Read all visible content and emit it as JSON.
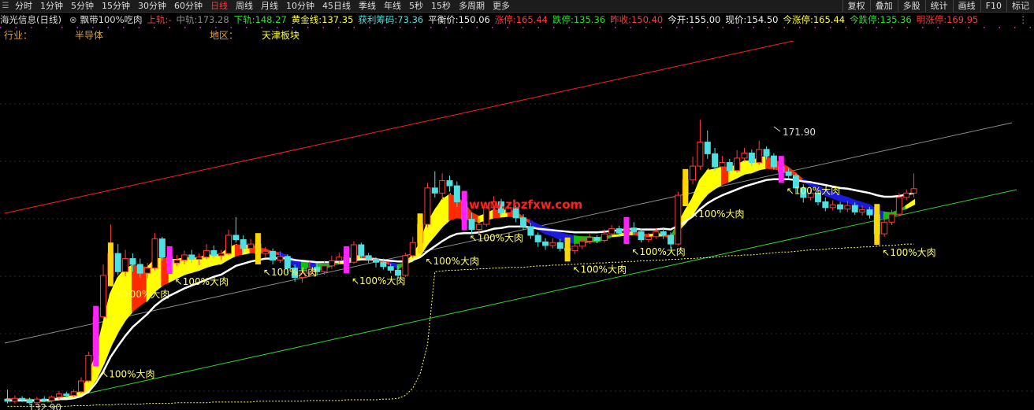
{
  "toolbar": {
    "periods": [
      "分时",
      "1分钟",
      "5分钟",
      "15分钟",
      "30分钟",
      "60分钟",
      "日线",
      "周线",
      "月线",
      "10分钟",
      "45日线",
      "季线",
      "年线",
      "5秒",
      "15秒",
      "多周期",
      "更多"
    ],
    "active_index": 6,
    "right_buttons": [
      "复权",
      "叠加",
      "多股",
      "统计",
      "画线",
      "F10",
      "标记"
    ]
  },
  "info": {
    "stock_title": "海光信息(日线)",
    "indicator_name": "飘带100%吃肉",
    "upper_label": "上轨:",
    "upper_value": "-",
    "mid_label": "中轨:",
    "mid_value": "173.28",
    "lower_label": "下轨:",
    "lower_value": "148.27",
    "gold_label": "黄金线:",
    "gold_value": "137.35",
    "profit_label": "获利筹码:",
    "profit_value": "73.36",
    "balance_label": "平衡价:",
    "balance_value": "150.06",
    "limitup_label": "涨停:",
    "limitup_value": "165.44",
    "limitdown_label": "跌停:",
    "limitdown_value": "135.36",
    "prevclose_label": "昨收:",
    "prevclose_value": "150.40",
    "open_label": "今开:",
    "open_value": "155.00",
    "price_label": "现价:",
    "price_value": "154.50",
    "todayup_label": "今涨停:",
    "todayup_value": "165.44",
    "todaydown_label": "今跌停:",
    "todaydown_value": "135.36",
    "tomorrowup_label": "明涨停:",
    "tomorrowup_value": "169.95"
  },
  "industry": {
    "industry_label": "行业：",
    "industry_value": "半导体",
    "region_label": "地区：",
    "region_value": "天津板块"
  },
  "colors": {
    "up": "#ff3b3b",
    "down": "#4de1e1",
    "ribbon_yellow": "#ffff00",
    "ribbon_red": "#ff2a00",
    "ribbon_blue": "#1b1bdd",
    "ribbon_green": "#10c010",
    "ribbon_white": "#ffffff",
    "signal_magenta": "#ff22ff",
    "signal_yellow": "#ffd700",
    "label_text": "#ffff66",
    "channel_top": "#ff2020",
    "channel_mid": "#8a8a8a",
    "channel_bottom": "#30d030",
    "profit_dotted": "#ffff55"
  },
  "chart_data": {
    "type": "candlestick",
    "title": "",
    "ylim": [
      130,
      180
    ],
    "high_label": "171.90",
    "low_label": "132.90",
    "signal_label": "100%大肉",
    "watermark": "www.zbzfxw.com",
    "candles": [
      [
        133.5,
        133.2,
        134.8,
        132.9
      ],
      [
        133.2,
        133.6,
        134.0,
        132.9
      ],
      [
        133.6,
        133.4,
        133.9,
        133.1
      ],
      [
        133.4,
        133.0,
        133.7,
        132.9
      ],
      [
        133.0,
        133.5,
        133.8,
        132.9
      ],
      [
        133.5,
        133.3,
        133.9,
        133.1
      ],
      [
        133.3,
        133.8,
        134.0,
        133.0
      ],
      [
        133.8,
        134.2,
        134.6,
        133.5
      ],
      [
        134.2,
        134.0,
        134.5,
        133.7
      ],
      [
        134.0,
        134.5,
        134.8,
        133.8
      ],
      [
        134.5,
        136.0,
        136.5,
        134.3
      ],
      [
        136.0,
        139.5,
        140.0,
        135.8
      ],
      [
        139.5,
        144.8,
        145.5,
        139.0
      ],
      [
        144.8,
        150.5,
        152.0,
        144.5
      ],
      [
        150.5,
        153.5,
        157.5,
        150.0
      ],
      [
        153.5,
        151.0,
        154.8,
        150.5
      ],
      [
        151.0,
        152.8,
        154.0,
        150.4
      ],
      [
        152.8,
        152.0,
        153.5,
        151.0
      ],
      [
        152.0,
        150.8,
        152.8,
        150.2
      ],
      [
        150.8,
        151.5,
        152.2,
        150.1
      ],
      [
        151.5,
        155.5,
        156.3,
        151.2
      ],
      [
        155.5,
        153.0,
        155.8,
        152.5
      ],
      [
        153.0,
        152.2,
        153.8,
        151.5
      ],
      [
        152.2,
        152.6,
        153.3,
        151.8
      ],
      [
        152.6,
        153.3,
        153.9,
        152.0
      ],
      [
        153.3,
        152.7,
        154.0,
        152.2
      ],
      [
        152.7,
        153.0,
        153.5,
        151.9
      ],
      [
        153.0,
        153.9,
        154.8,
        152.7
      ],
      [
        153.9,
        153.2,
        154.6,
        152.8
      ],
      [
        153.2,
        153.5,
        154.0,
        152.6
      ],
      [
        153.5,
        156.0,
        156.8,
        153.3
      ],
      [
        156.0,
        155.4,
        158.5,
        155.0
      ],
      [
        155.4,
        154.2,
        156.0,
        153.6
      ],
      [
        154.2,
        154.8,
        155.5,
        153.8
      ],
      [
        154.8,
        153.5,
        155.3,
        153.0
      ],
      [
        153.5,
        153.8,
        154.4,
        153.0
      ],
      [
        153.8,
        152.6,
        154.2,
        152.0
      ],
      [
        152.6,
        153.1,
        153.8,
        152.2
      ],
      [
        153.1,
        151.5,
        153.4,
        150.8
      ],
      [
        151.5,
        150.2,
        152.0,
        149.6
      ],
      [
        150.2,
        150.8,
        151.5,
        149.5
      ],
      [
        150.8,
        151.6,
        152.4,
        150.4
      ],
      [
        151.6,
        151.0,
        152.0,
        150.5
      ],
      [
        151.0,
        151.8,
        152.5,
        150.6
      ],
      [
        151.8,
        152.5,
        153.2,
        151.4
      ],
      [
        152.5,
        153.0,
        153.6,
        152.0
      ],
      [
        153.0,
        152.3,
        153.4,
        151.9
      ],
      [
        152.3,
        154.7,
        155.2,
        152.1
      ],
      [
        154.7,
        153.2,
        155.0,
        152.8
      ],
      [
        153.2,
        152.7,
        153.6,
        152.2
      ],
      [
        152.7,
        152.3,
        153.0,
        151.6
      ],
      [
        152.3,
        151.7,
        152.8,
        151.3
      ],
      [
        151.7,
        151.2,
        152.1,
        150.8
      ],
      [
        151.2,
        150.5,
        151.8,
        150.1
      ],
      [
        150.5,
        153.2,
        153.6,
        150.3
      ],
      [
        153.2,
        155.0,
        155.8,
        152.9
      ],
      [
        155.0,
        157.5,
        158.4,
        154.7
      ],
      [
        157.5,
        162.5,
        163.2,
        157.1
      ],
      [
        162.5,
        161.8,
        164.8,
        161.2
      ],
      [
        161.8,
        163.5,
        164.5,
        160.9
      ],
      [
        163.5,
        162.8,
        164.2,
        162.0
      ],
      [
        162.8,
        160.6,
        163.4,
        159.9
      ],
      [
        160.6,
        158.2,
        161.2,
        157.5
      ],
      [
        158.2,
        156.8,
        159.1,
        156.2
      ],
      [
        156.8,
        157.5,
        158.3,
        156.1
      ],
      [
        157.5,
        159.8,
        160.5,
        157.2
      ],
      [
        159.8,
        160.6,
        161.4,
        159.2
      ],
      [
        160.6,
        159.1,
        161.0,
        158.7
      ],
      [
        159.1,
        159.8,
        160.5,
        158.8
      ],
      [
        159.8,
        158.4,
        160.1,
        157.8
      ],
      [
        158.4,
        157.2,
        158.9,
        156.7
      ],
      [
        157.2,
        156.0,
        157.7,
        155.5
      ],
      [
        156.0,
        155.1,
        156.4,
        154.4
      ],
      [
        155.1,
        154.6,
        155.6,
        154.0
      ],
      [
        154.6,
        155.0,
        155.6,
        154.2
      ],
      [
        155.0,
        154.2,
        155.5,
        153.8
      ],
      [
        154.2,
        153.9,
        154.7,
        153.2
      ],
      [
        153.9,
        154.5,
        155.0,
        153.4
      ],
      [
        154.5,
        155.2,
        155.8,
        154.1
      ],
      [
        155.2,
        155.7,
        156.2,
        154.8
      ],
      [
        155.7,
        155.3,
        156.0,
        154.9
      ],
      [
        155.3,
        156.2,
        156.8,
        155.0
      ],
      [
        156.2,
        156.9,
        157.4,
        155.9
      ],
      [
        156.9,
        156.3,
        157.3,
        155.8
      ],
      [
        156.3,
        157.0,
        157.5,
        155.9
      ],
      [
        157.0,
        156.5,
        157.8,
        156.1
      ],
      [
        156.5,
        155.4,
        156.9,
        155.0
      ],
      [
        155.4,
        155.8,
        156.3,
        155.0
      ],
      [
        155.8,
        156.5,
        157.0,
        155.5
      ],
      [
        156.5,
        156.0,
        156.9,
        155.5
      ],
      [
        156.0,
        154.8,
        156.4,
        154.2
      ],
      [
        154.8,
        161.5,
        162.0,
        154.6
      ],
      [
        161.5,
        163.6,
        164.8,
        161.0
      ],
      [
        163.6,
        165.5,
        166.8,
        163.0
      ],
      [
        165.5,
        168.8,
        171.9,
        165.0
      ],
      [
        168.8,
        167.2,
        170.4,
        166.5
      ],
      [
        167.2,
        165.4,
        168.0,
        164.8
      ],
      [
        165.4,
        166.0,
        166.9,
        164.8
      ],
      [
        166.0,
        164.9,
        166.5,
        164.3
      ],
      [
        164.9,
        166.6,
        167.7,
        164.6
      ],
      [
        166.6,
        167.3,
        168.0,
        166.2
      ],
      [
        167.3,
        166.0,
        167.8,
        165.5
      ],
      [
        166.0,
        167.8,
        169.0,
        165.7
      ],
      [
        167.8,
        166.9,
        168.2,
        166.4
      ],
      [
        166.9,
        165.4,
        167.3,
        165.0
      ],
      [
        165.4,
        164.7,
        165.9,
        164.2
      ],
      [
        164.7,
        164.2,
        165.2,
        163.7
      ],
      [
        164.2,
        162.5,
        164.5,
        161.8
      ],
      [
        162.5,
        161.2,
        163.0,
        160.5
      ],
      [
        161.2,
        161.8,
        162.3,
        160.8
      ],
      [
        161.8,
        160.6,
        162.2,
        160.1
      ],
      [
        160.6,
        159.8,
        161.2,
        159.3
      ],
      [
        159.8,
        160.2,
        160.8,
        159.4
      ],
      [
        160.2,
        159.6,
        160.6,
        159.1
      ],
      [
        159.6,
        160.1,
        160.7,
        159.2
      ],
      [
        160.1,
        159.2,
        160.5,
        158.8
      ],
      [
        159.2,
        159.5,
        160.1,
        158.7
      ],
      [
        159.5,
        158.8,
        159.9,
        158.3
      ],
      [
        158.8,
        156.2,
        159.1,
        154.9
      ],
      [
        156.2,
        157.8,
        158.2,
        155.8
      ],
      [
        157.8,
        158.9,
        159.5,
        157.4
      ],
      [
        158.9,
        161.2,
        161.8,
        158.6
      ],
      [
        161.2,
        161.8,
        162.3,
        160.8
      ],
      [
        161.8,
        162.4,
        164.5,
        161.2
      ]
    ],
    "ribbon_fast": [
      133.5,
      133.4,
      133.4,
      133.3,
      133.3,
      133.3,
      133.4,
      133.6,
      133.7,
      133.9,
      134.6,
      136.3,
      139.5,
      143.7,
      147.9,
      150.1,
      151.3,
      151.8,
      151.6,
      151.5,
      152.6,
      152.8,
      152.6,
      152.6,
      152.8,
      152.8,
      152.8,
      153.2,
      153.2,
      153.3,
      154.2,
      154.6,
      154.5,
      154.6,
      154.2,
      154.0,
      153.6,
      153.4,
      152.7,
      151.8,
      151.4,
      151.5,
      151.3,
      151.5,
      151.9,
      152.3,
      152.3,
      153.1,
      153.1,
      153.0,
      152.7,
      152.4,
      152.0,
      151.5,
      152.1,
      153.2,
      154.8,
      157.6,
      159.3,
      160.8,
      161.5,
      161.2,
      160.2,
      159.0,
      158.5,
      158.9,
      159.4,
      159.3,
      159.4,
      159.1,
      158.4,
      157.7,
      156.9,
      156.3,
      156.0,
      155.5,
      155.1,
      155.0,
      155.0,
      155.2,
      155.2,
      155.5,
      155.9,
      156.0,
      156.3,
      156.4,
      156.1,
      156.0,
      156.1,
      156.1,
      155.7,
      157.5,
      159.3,
      161.0,
      163.5,
      164.8,
      165.0,
      165.3,
      165.2,
      165.6,
      166.1,
      166.1,
      166.6,
      166.7,
      166.3,
      165.8,
      165.2,
      164.4,
      163.5,
      162.9,
      162.3,
      161.6,
      161.2,
      160.8,
      160.6,
      160.2,
      160.0,
      159.6,
      158.6,
      158.3,
      158.5,
      159.3,
      160.0,
      160.7
    ],
    "ribbon_slow": [
      133.4,
      133.4,
      133.4,
      133.4,
      133.3,
      133.3,
      133.4,
      133.5,
      133.6,
      133.7,
      134.0,
      134.8,
      136.3,
      138.4,
      140.9,
      142.9,
      144.5,
      145.7,
      146.5,
      147.2,
      148.4,
      149.2,
      149.7,
      150.2,
      150.7,
      151.0,
      151.3,
      151.7,
      152.0,
      152.2,
      152.8,
      153.3,
      153.5,
      153.7,
      153.7,
      153.7,
      153.6,
      153.5,
      153.1,
      152.6,
      152.3,
      152.2,
      152.0,
      151.9,
      152.0,
      152.2,
      152.2,
      152.6,
      152.7,
      152.7,
      152.6,
      152.4,
      152.2,
      151.9,
      152.1,
      152.6,
      153.4,
      154.9,
      156.1,
      157.3,
      158.2,
      158.5,
      158.4,
      158.1,
      157.9,
      158.2,
      158.5,
      158.6,
      158.7,
      158.6,
      158.3,
      157.9,
      157.4,
      157.0,
      156.7,
      156.3,
      156.0,
      155.8,
      155.7,
      155.7,
      155.6,
      155.7,
      155.9,
      156.0,
      156.1,
      156.2,
      156.0,
      156.0,
      156.0,
      156.0,
      155.8,
      156.7,
      157.8,
      159.0,
      160.6,
      161.8,
      162.5,
      163.1,
      163.5,
      164.0,
      164.5,
      164.7,
      165.1,
      165.3,
      165.2,
      165.0,
      164.7,
      164.2,
      163.6,
      163.2,
      162.7,
      162.2,
      161.8,
      161.4,
      161.1,
      160.7,
      160.4,
      160.1,
      159.4,
      159.1,
      159.0,
      159.4,
      159.8,
      160.3
    ],
    "white_line": [
      133.3,
      133.3,
      133.3,
      133.3,
      133.3,
      133.3,
      133.4,
      133.5,
      133.5,
      133.6,
      133.9,
      134.5,
      135.7,
      137.3,
      139.3,
      140.8,
      142.2,
      143.4,
      144.3,
      145.2,
      146.3,
      147.1,
      147.7,
      148.2,
      148.7,
      149.1,
      149.5,
      149.9,
      150.3,
      150.6,
      151.2,
      151.8,
      152.1,
      152.4,
      152.6,
      152.8,
      152.8,
      152.9,
      152.8,
      152.6,
      152.5,
      152.4,
      152.3,
      152.3,
      152.3,
      152.4,
      152.4,
      152.6,
      152.7,
      152.7,
      152.7,
      152.6,
      152.5,
      152.4,
      152.4,
      152.6,
      153.0,
      153.8,
      154.5,
      155.2,
      155.8,
      156.2,
      156.3,
      156.3,
      156.4,
      156.6,
      156.9,
      157.0,
      157.2,
      157.2,
      157.2,
      157.1,
      156.9,
      156.8,
      156.7,
      156.6,
      156.5,
      156.4,
      156.4,
      156.4,
      156.4,
      156.5,
      156.6,
      156.7,
      156.8,
      156.9,
      156.8,
      156.8,
      156.8,
      156.9,
      156.8,
      157.3,
      157.9,
      158.6,
      159.6,
      160.4,
      161.0,
      161.5,
      161.9,
      162.3,
      162.7,
      163.0,
      163.3,
      163.6,
      163.7,
      163.7,
      163.7,
      163.6,
      163.4,
      163.3,
      163.1,
      162.9,
      162.7,
      162.5,
      162.4,
      162.2,
      162.0,
      161.8,
      161.5,
      161.3,
      161.3,
      161.4,
      161.6,
      161.8
    ],
    "profit_line": [
      132.5,
      132.5,
      132.5,
      132.5,
      132.5,
      132.5,
      132.5,
      132.5,
      132.5,
      132.6,
      132.6,
      132.6,
      132.7,
      132.7,
      132.7,
      132.8,
      132.8,
      132.8,
      132.8,
      132.9,
      132.9,
      132.9,
      132.9,
      133.0,
      133.0,
      133.0,
      133.0,
      133.0,
      133.1,
      133.1,
      133.1,
      133.1,
      133.1,
      133.1,
      133.2,
      133.2,
      133.2,
      133.2,
      133.2,
      133.2,
      133.2,
      133.3,
      133.3,
      133.3,
      133.3,
      133.3,
      133.4,
      133.4,
      133.4,
      133.4,
      133.4,
      133.5,
      133.5,
      133.6,
      134.0,
      135.0,
      137.0,
      141.0,
      151.0,
      151.1,
      151.2,
      151.2,
      151.3,
      151.3,
      151.4,
      151.4,
      151.5,
      151.5,
      151.6,
      151.6,
      151.6,
      151.7,
      151.8,
      151.8,
      151.9,
      151.9,
      152.0,
      152.0,
      152.1,
      152.1,
      152.2,
      152.2,
      152.3,
      152.3,
      152.4,
      152.4,
      152.5,
      152.5,
      152.6,
      152.6,
      152.7,
      152.7,
      152.8,
      152.8,
      152.9,
      152.9,
      153.0,
      153.1,
      153.2,
      153.2,
      153.3,
      153.3,
      153.4,
      153.5,
      153.6,
      153.7,
      153.7,
      153.8,
      153.9,
      154.0,
      154.0,
      154.1,
      154.2,
      154.2,
      154.3,
      154.3,
      154.4,
      154.4,
      154.5,
      154.6,
      154.6,
      154.7,
      154.8,
      154.8
    ],
    "signals": [
      12,
      14,
      22,
      34,
      46,
      56,
      62,
      76,
      84,
      92,
      105,
      118
    ]
  }
}
